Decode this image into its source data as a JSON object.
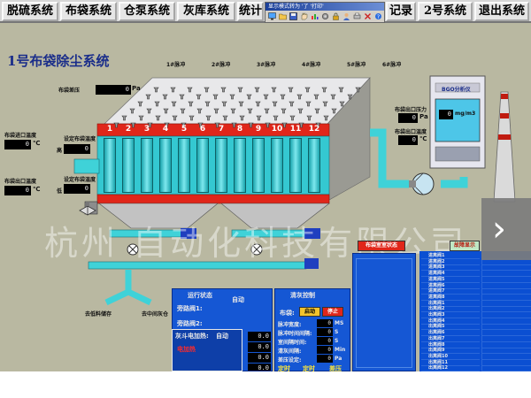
{
  "menu": {
    "items": [
      "脱硫系统",
      "布袋系统",
      "仓泵系统",
      "灰库系统",
      "统计",
      "记录",
      "2号系统",
      "退出系统"
    ]
  },
  "tool_window": {
    "title": "显示模式转为 '了 '打印'"
  },
  "page": {
    "system_title": "1号布袋除尘系统",
    "watermark": "杭州  自动化科技有限公司"
  },
  "pulse_labels": [
    "1#脉冲",
    "2#脉冲",
    "3#脉冲",
    "4#脉冲",
    "5#脉冲",
    "6#脉冲"
  ],
  "bag_numbers": [
    "1",
    "2",
    "3",
    "4",
    "5",
    "6",
    "7",
    "8",
    "9",
    "10",
    "11",
    "12"
  ],
  "left_readings": {
    "bag_pressure_label": "布袋差压",
    "bag_pressure_value": "0",
    "bag_pressure_unit": "Pa",
    "inlet_temp_label": "布袋进口温度",
    "inlet_temp_value": "0",
    "inlet_temp_unit": "℃",
    "inlet_set_label": "设定布袋温度",
    "inlet_set_value": "0",
    "inlet_set_tag": "高",
    "outlet_temp_label": "布袋出口温度",
    "outlet_temp_value": "0",
    "outlet_temp_unit": "℃",
    "outlet_set_label": "设定布袋温度",
    "outlet_set_value": "0",
    "outlet_set_tag": "低"
  },
  "right_readings": {
    "outlet_pressure_label": "布袋出口压力",
    "outlet_pressure_value": "0",
    "outlet_pressure_unit": "Pa",
    "outlet_temp_label": "布袋出口温度",
    "outlet_temp_value": "0",
    "outlet_temp_unit": "℃"
  },
  "analyzer": {
    "title": "BGO分析仪",
    "unit": "mg/m3",
    "value": "0"
  },
  "discharge_labels": [
    "去低料储存",
    "去中间灰仓"
  ],
  "run_status": {
    "header": "运行状态",
    "valve1_label": "旁路阀1:",
    "valve1_value": "自动",
    "valve2_label": "旁路阀2:",
    "valve2_value": "",
    "heater_label": "灰斗电加热:",
    "heater_mode": "自动",
    "heater_state": "电加热",
    "values": [
      "0.0",
      "0.0",
      "0.0",
      "0.0"
    ]
  },
  "cleaning": {
    "header": "清灰控制",
    "mode_label": "布袋:",
    "start_button": "启动",
    "stop_button": "停止",
    "rows": [
      {
        "label": "脉冲宽度:",
        "value": "0",
        "unit": "MS"
      },
      {
        "label": "脉冲时间间隔:",
        "value": "0",
        "unit": "S"
      },
      {
        "label": "室间隔时间:",
        "value": "0",
        "unit": "S"
      },
      {
        "label": "清灰间隔:",
        "value": "0",
        "unit": "Min"
      },
      {
        "label": "差压设定:",
        "value": "0",
        "unit": "Pa"
      }
    ],
    "footer": [
      "定时",
      "定时",
      "差压"
    ]
  },
  "bag_room_status": {
    "header": "布袋室室状态"
  },
  "fault_header": "故障显示",
  "right_table_rows": [
    "进离阀1",
    "进离阀2",
    "进离阀3",
    "进离阀4",
    "进离阀5",
    "进离阀6",
    "进离阀7",
    "进离阀8",
    "出离阀1",
    "出离阀2",
    "出离阀3",
    "出离阀4",
    "出离阀5",
    "出离阀6",
    "出离阀7",
    "出离阀8",
    "出离阀9",
    "出离阀10",
    "出离阀11",
    "出离阀12"
  ],
  "colors": {
    "background": "#b9b8a1",
    "panel_blue": "#1557d4",
    "duct_cyan": "#3fd2d8",
    "red": "#e0261a"
  }
}
